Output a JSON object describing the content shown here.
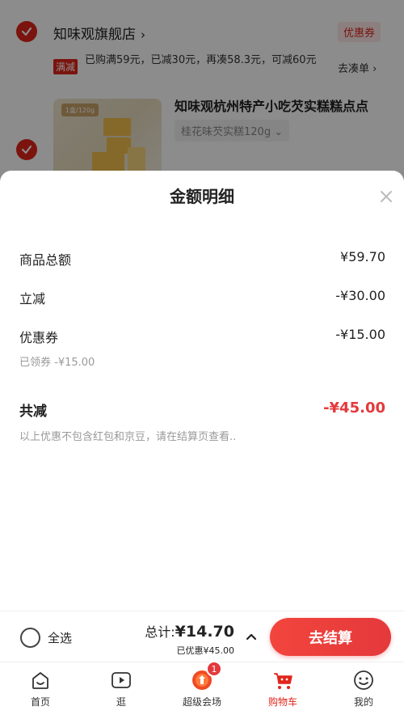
{
  "store": {
    "name": "知味观旗舰店",
    "chevron": "›",
    "coupon_tag": "优惠券",
    "promo_tag": "满减",
    "promo_text": "已购满59元，已减30元，再凑58.3元，可减60元",
    "add_more": "去凑单 ›"
  },
  "product": {
    "title": "知味观杭州特产小吃芡实糕糕点点",
    "sku": "桂花味芡实糕120g  ⌄",
    "image_label": "1盒/120g"
  },
  "sheet": {
    "title": "金额明细",
    "close_icon": "close-icon",
    "rows": [
      {
        "label": "商品总额",
        "value": "¥59.70"
      },
      {
        "label": "立减",
        "value": "-¥30.00"
      },
      {
        "label": "优惠券",
        "value": "-¥15.00"
      }
    ],
    "coupon_sub": "已领券 -¥15.00",
    "total_label": "共减",
    "total_value": "-¥45.00",
    "note": "以上优惠不包含红包和京豆，请在结算页查看.."
  },
  "checkout": {
    "select_all": "全选",
    "sum_prefix": "总计:",
    "sum_amount": "¥14.70",
    "saved": "已优惠¥45.00",
    "button": "去结算"
  },
  "tabbar": {
    "tabs": [
      {
        "label": "首页",
        "icon": "home-icon"
      },
      {
        "label": "逛",
        "icon": "play-icon"
      },
      {
        "label": "超级会场",
        "icon": "venue-icon"
      },
      {
        "label": "购物车",
        "icon": "cart-icon"
      },
      {
        "label": "我的",
        "icon": "smile-icon"
      }
    ],
    "badge": "1"
  },
  "colors": {
    "accent": "#e1251b",
    "price_red": "#e4393c"
  }
}
